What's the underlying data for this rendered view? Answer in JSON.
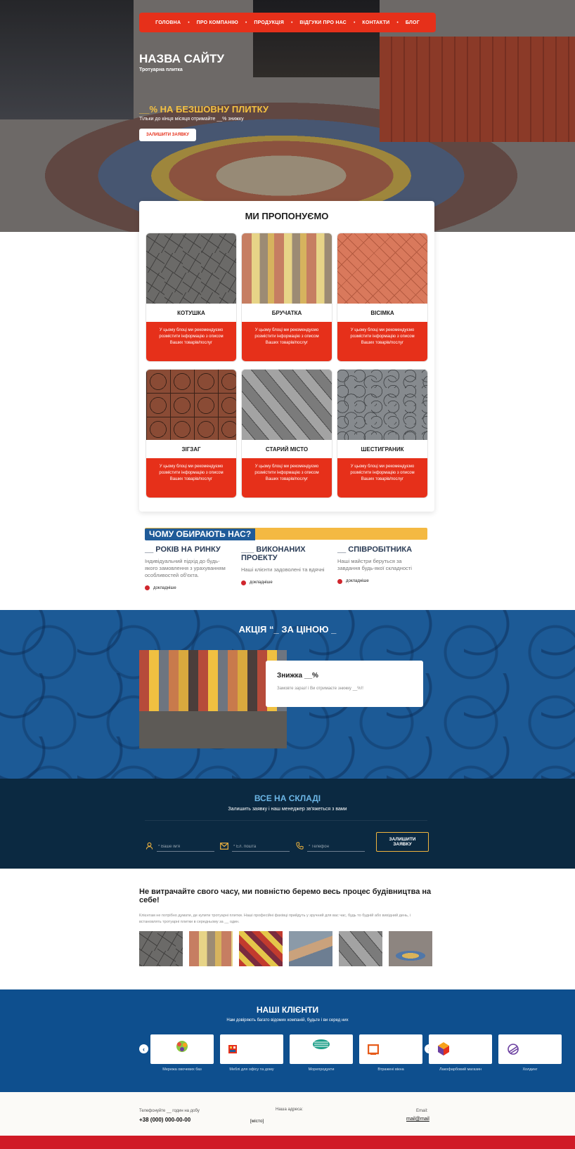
{
  "nav": [
    "ГОЛОВНА",
    "ПРО КОМПАНІЮ",
    "ПРОДУКЦІЯ",
    "ВІДГУКИ ПРО НАС",
    "КОНТАКТИ",
    "БЛОГ"
  ],
  "hero": {
    "title": "НАЗВА САЙТУ",
    "subtitle": "Тротуарна плитка",
    "promo_title": "__% НА БЕЗШОВНУ ПЛИТКУ",
    "promo_text": "Тільки до кінця місяця отримайте __% знижку",
    "button": "ЗАЛИШИТИ ЗАЯВКУ"
  },
  "offer": {
    "title": "МИ ПРОПОНУЄМО",
    "items": [
      {
        "name": "КОТУШКА",
        "desc": "У цьому блоці ми рекомендуємо розмістити інформацію з описом Ваших товарів/послуг"
      },
      {
        "name": "БРУЧАТКА",
        "desc": "У цьому блоці ми рекомендуємо розмістити інформацію з описом Ваших товарів/послуг"
      },
      {
        "name": "ВІСІМКА",
        "desc": "У цьому блоці ми рекомендуємо розмістити інформацію з описом Ваших товарів/послуг"
      },
      {
        "name": "ЗІГЗАГ",
        "desc": "У цьому блоці ми рекомендуємо розмістити інформацію з описом Ваших товарів/послуг"
      },
      {
        "name": "СТАРИЙ МІСТО",
        "desc": "У цьому блоці ми рекомендуємо розмістити інформацію з описом Ваших товарів/послуг"
      },
      {
        "name": "ШЕСТИГРАНИК",
        "desc": "У цьому блоці ми рекомендуємо розмістити інформацію з описом Ваших товарів/послуг"
      }
    ]
  },
  "why": {
    "title": "ЧОМУ ОБИРАЮТЬ НАС?",
    "cols": [
      {
        "title": "__ РОКІВ НА РИНКУ",
        "text": "Індивідуальний підхід до будь-якого замовлення з урахуванням особливостей об'єкта.",
        "more": "докладніше"
      },
      {
        "title": "___ ВИКОНАНИХ ПРОЕКТУ",
        "text": "Наші клієнти задоволені та вдячні",
        "more": "докладніше"
      },
      {
        "title": "__ СПІВРОБІТНИКА",
        "text": "Наші майстри беруться за завдання будь-якої складності",
        "more": "докладніше"
      }
    ]
  },
  "action": {
    "title": "АКЦІЯ “_ ЗА ЦІНОЮ _",
    "box_title": "Знижка __%",
    "box_text": "Замовте зараз! і Ви отримаєте знижку __%!!"
  },
  "warehouse": {
    "title": "ВСЕ НА СКЛАДІ",
    "subtitle": "Залишить заявку і наш менеджер зв'яжеться з вами",
    "name_placeholder": "* Ваше ім'я",
    "email_placeholder": "* Ел. пошта",
    "phone_placeholder": "* Телефон",
    "button": "ЗАЛИШИТИ ЗАЯВКУ"
  },
  "build": {
    "title": "Не витрачайте свого часу, ми повністю беремо весь процес будівництва на себе!",
    "text": "Клієнтам не потрібно думати, де купити тротуарні плитки. Наші професійні фахівці прийдуть у зручний для вас час, будь то будній або вихідний день, і встановлять тротуарні плитки в середньому за __ один."
  },
  "clients": {
    "title": "НАШІ КЛІЄНТИ",
    "subtitle": "Нам довіряють багато відомих компаній, будьте і ви серед них",
    "items": [
      "Мережа овочевих баз",
      "Меблі для офісу та дому",
      "Морепродукти",
      "Втражені вікна",
      "Лакофарбовий магазин",
      "Холдинг"
    ]
  },
  "footer": {
    "phone_label": "Телефонуйте __ годин на добу",
    "phone": "+38 (000) 000-00-00",
    "address_label": "Наша адреса:",
    "address": "[місто]",
    "email_label": "Email:",
    "email": "mail@mail"
  }
}
